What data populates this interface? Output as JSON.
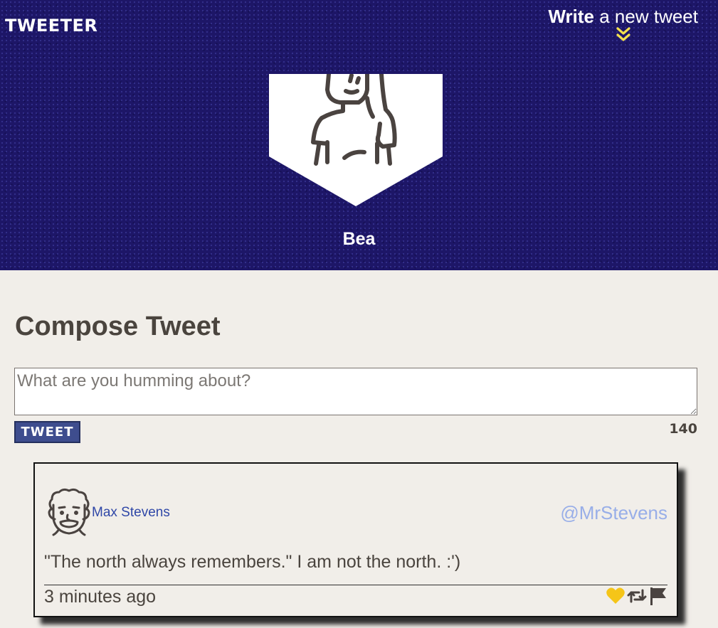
{
  "header": {
    "brand": "TWEETER",
    "compose_link_strong": "Write",
    "compose_link_rest": " a new tweet",
    "chevron_icon": "chevron-double-down-icon",
    "chevron_color": "#f4e04d",
    "profile_name": "Bea",
    "profile_avatar_icon": "person-avatar-icon"
  },
  "compose": {
    "title": "Compose Tweet",
    "placeholder": "What are you humming about?",
    "value": "",
    "button_label": "TWEET",
    "char_counter": "140"
  },
  "tweets": [
    {
      "avatar_icon": "man-avatar-icon",
      "name": "Max Stevens",
      "handle": "@MrStevens",
      "text": "\"The north always remembers.\" I am not the north. :')",
      "time": "3 minutes ago",
      "actions": [
        "heart-icon",
        "retweet-icon",
        "flag-icon"
      ]
    }
  ],
  "colors": {
    "header_bg": "#1d1667",
    "page_bg": "#f1eee9",
    "button_bg": "#3e4d8e",
    "name_link": "#2f47a7",
    "handle": "#98aee8",
    "heart": "#f5c518"
  }
}
